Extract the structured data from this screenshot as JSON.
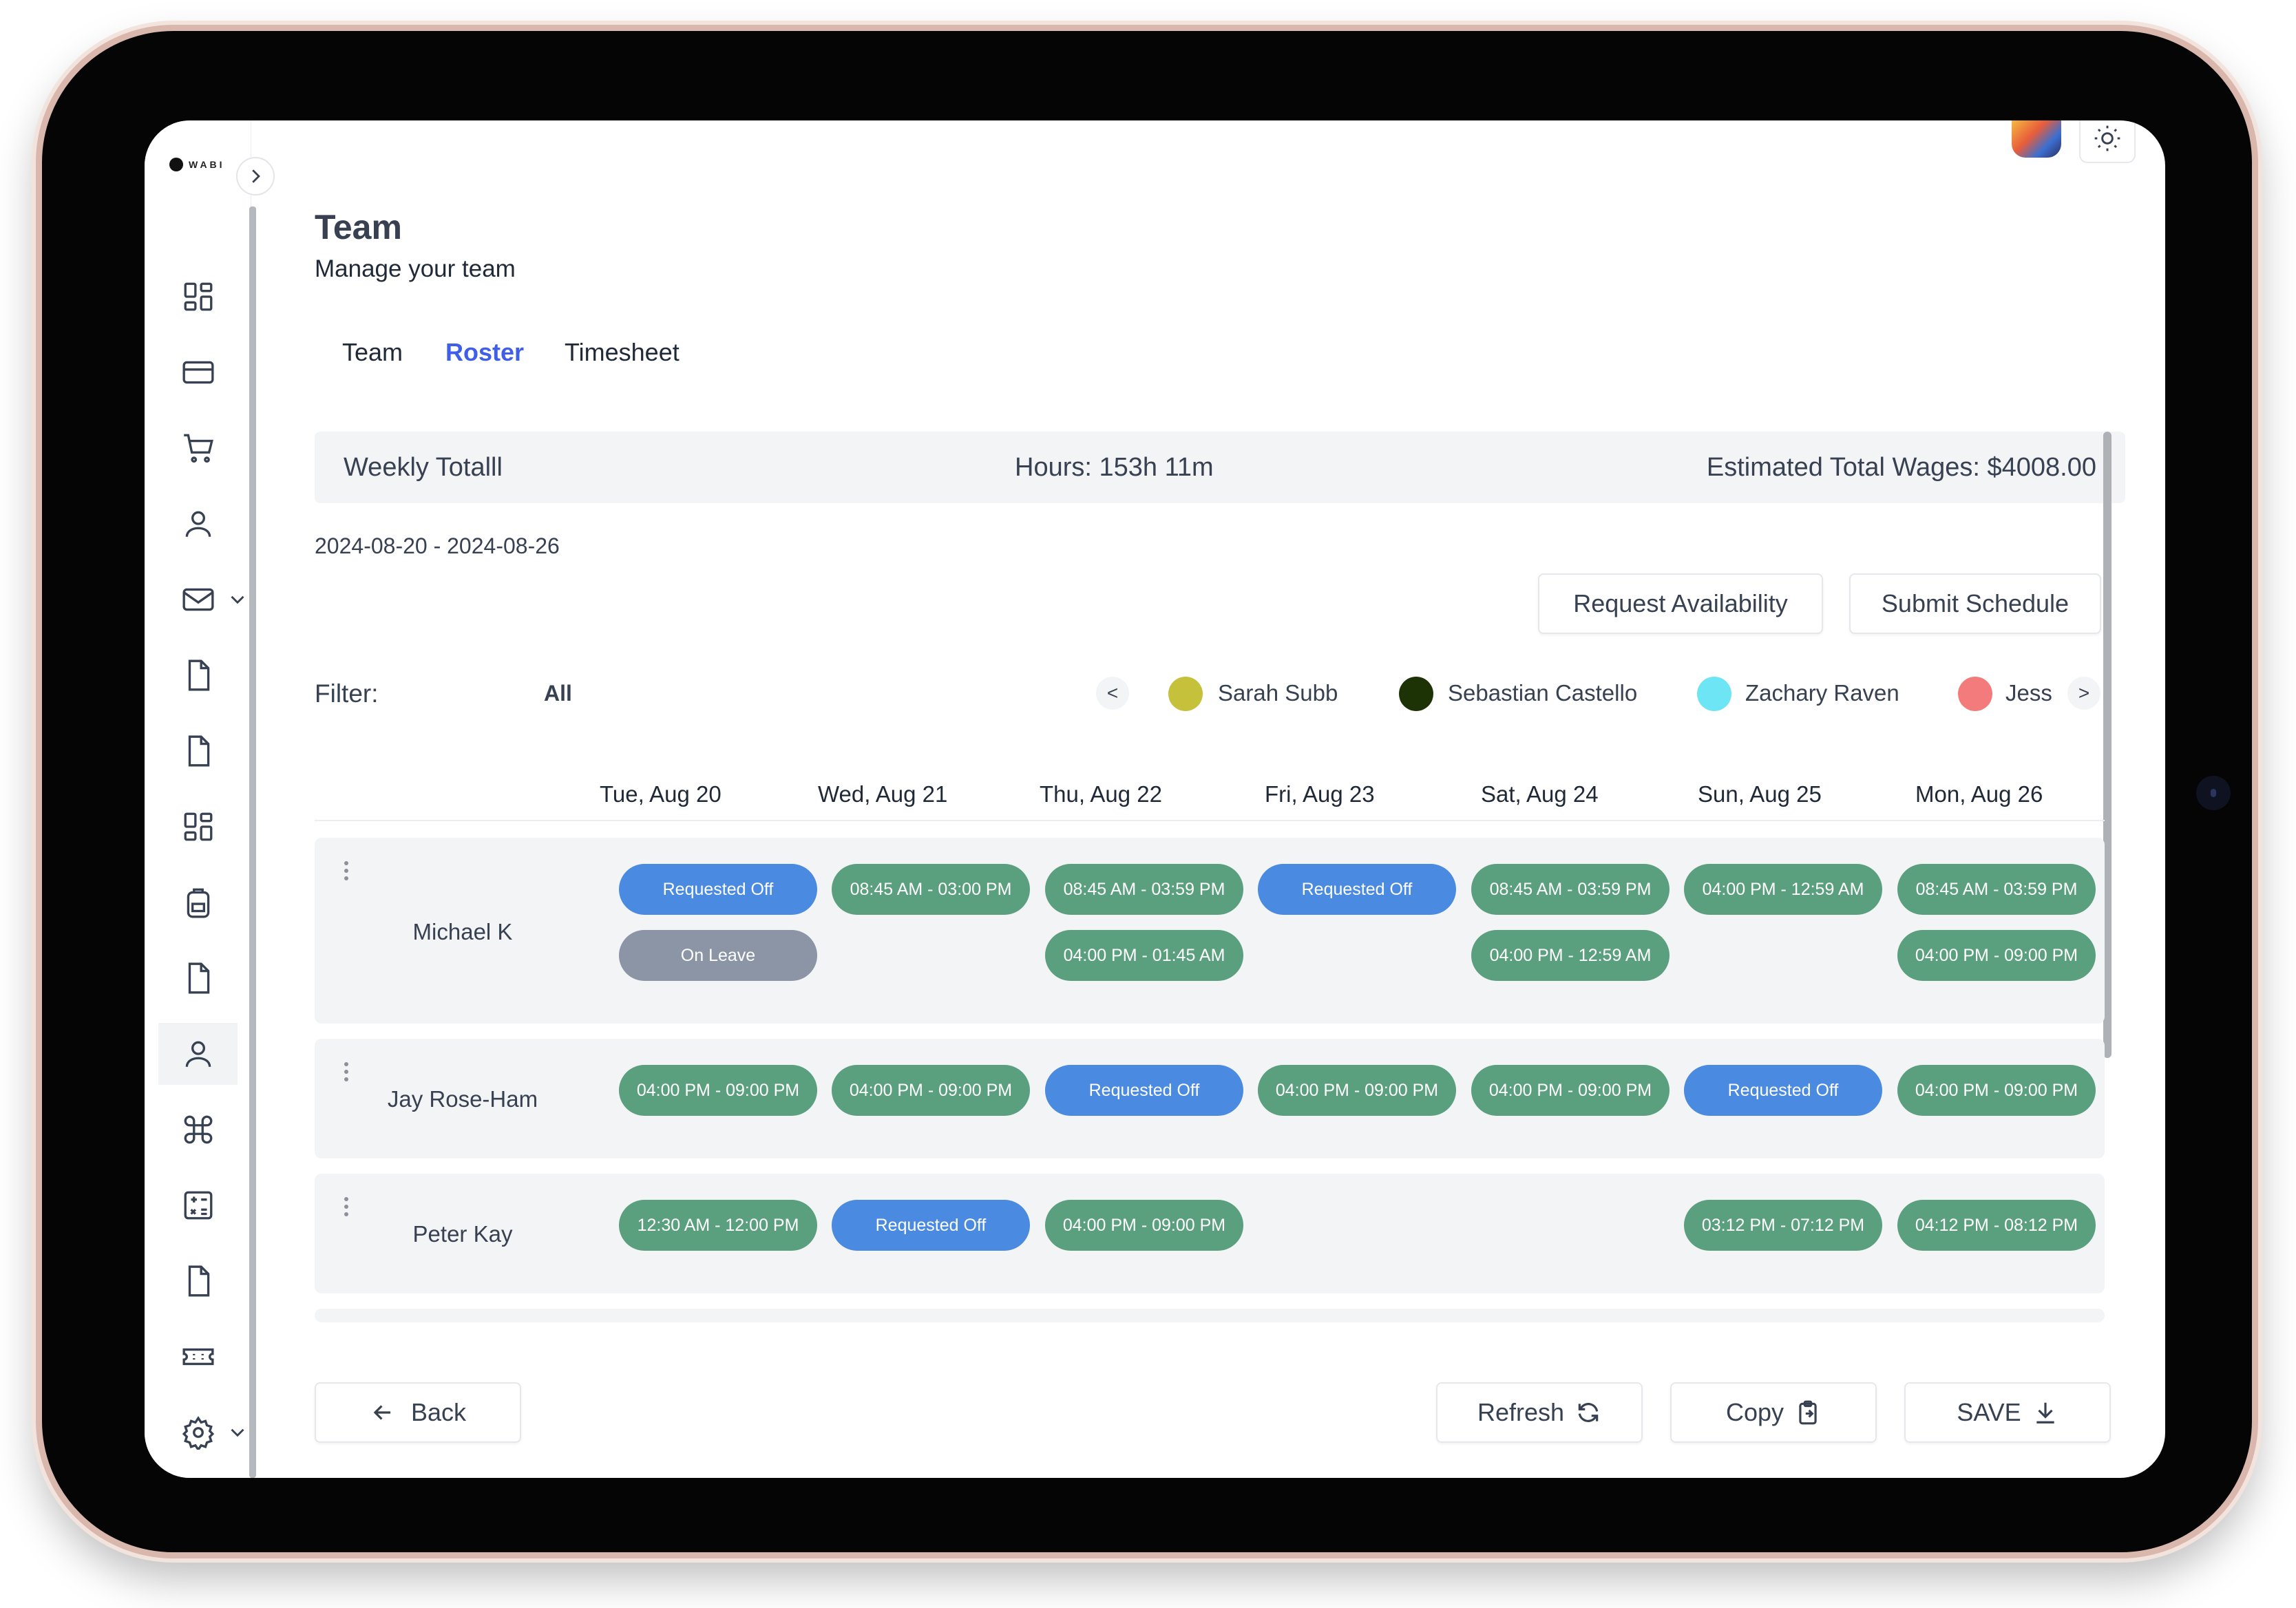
{
  "app": {
    "logo_text": "WABI"
  },
  "header": {
    "title": "Team",
    "subtitle": "Manage your team"
  },
  "tabs": [
    {
      "label": "Team",
      "active": false
    },
    {
      "label": "Roster",
      "active": true
    },
    {
      "label": "Timesheet",
      "active": false
    }
  ],
  "weekly": {
    "label": "Weekly Totalll",
    "hours": "Hours: 153h 11m",
    "wages": "Estimated Total Wages: $4008.00"
  },
  "date_range": "2024-08-20 - 2024-08-26",
  "actions": {
    "request_availability": "Request Availability",
    "submit_schedule": "Submit Schedule"
  },
  "filter": {
    "label": "Filter:",
    "value": "All",
    "prev": "<",
    "next": ">",
    "members": [
      {
        "name": "Sarah Subb",
        "color": "#c6c13b"
      },
      {
        "name": "Sebastian Castello",
        "color": "#1d3305"
      },
      {
        "name": "Zachary Raven",
        "color": "#6ee5f5"
      },
      {
        "name": "Jess",
        "color": "#f47b7b"
      }
    ]
  },
  "days": [
    "Tue, Aug 20",
    "Wed, Aug 21",
    "Thu, Aug 22",
    "Fri, Aug 23",
    "Sat, Aug 24",
    "Sun, Aug 25",
    "Mon, Aug 26"
  ],
  "roster": [
    {
      "name": "Michael K",
      "shifts": [
        [
          "Requested Off",
          "On Leave"
        ],
        [
          "08:45 AM - 03:00 PM"
        ],
        [
          "08:45 AM - 03:59 PM",
          "04:00 PM - 01:45 AM"
        ],
        [
          "Requested Off"
        ],
        [
          "08:45 AM - 03:59 PM",
          "04:00 PM - 12:59 AM"
        ],
        [
          "04:00 PM - 12:59 AM"
        ],
        [
          "08:45 AM - 03:59 PM",
          "04:00 PM - 09:00 PM"
        ]
      ]
    },
    {
      "name": "Jay Rose-Ham",
      "shifts": [
        [
          "04:00 PM - 09:00 PM"
        ],
        [
          "04:00 PM - 09:00 PM"
        ],
        [
          "Requested Off"
        ],
        [
          "04:00 PM - 09:00 PM"
        ],
        [
          "04:00 PM - 09:00 PM"
        ],
        [
          "Requested Off"
        ],
        [
          "04:00 PM - 09:00 PM"
        ]
      ]
    },
    {
      "name": "Peter Kay",
      "shifts": [
        [
          "12:30 AM - 12:00 PM"
        ],
        [
          "Requested Off"
        ],
        [
          "04:00 PM - 09:00 PM"
        ],
        [],
        [],
        [
          "03:12 PM - 07:12 PM"
        ],
        [
          "04:12 PM - 08:12 PM"
        ]
      ]
    }
  ],
  "footer": {
    "back": "Back",
    "refresh": "Refresh",
    "copy": "Copy",
    "save": "SAVE"
  },
  "colors": {
    "accent": "#3f5fe8",
    "shift": "#5ba07e",
    "requested_off": "#4a8ae0",
    "on_leave": "#8b95a6"
  }
}
